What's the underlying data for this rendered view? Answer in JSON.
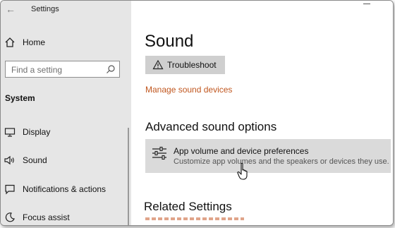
{
  "window": {
    "app_title": "Settings"
  },
  "sidebar": {
    "home_label": "Home",
    "search_placeholder": "Find a setting",
    "section_label": "System",
    "items": [
      {
        "label": "Display",
        "icon": "monitor-icon"
      },
      {
        "label": "Sound",
        "icon": "speaker-icon"
      },
      {
        "label": "Notifications & actions",
        "icon": "notification-icon"
      },
      {
        "label": "Focus assist",
        "icon": "moon-icon"
      }
    ]
  },
  "main": {
    "title": "Sound",
    "troubleshoot_label": "Troubleshoot",
    "manage_link": "Manage sound devices",
    "advanced_heading": "Advanced sound options",
    "app_volume": {
      "title": "App volume and device preferences",
      "subtitle": "Customize app volumes and the speakers or devices they use."
    },
    "related_heading": "Related Settings"
  },
  "colors": {
    "sidebar_bg": "#e6e6e6",
    "link": "#c0561e",
    "button_bg": "#cfcfcf",
    "hover_bg": "#dadada"
  }
}
